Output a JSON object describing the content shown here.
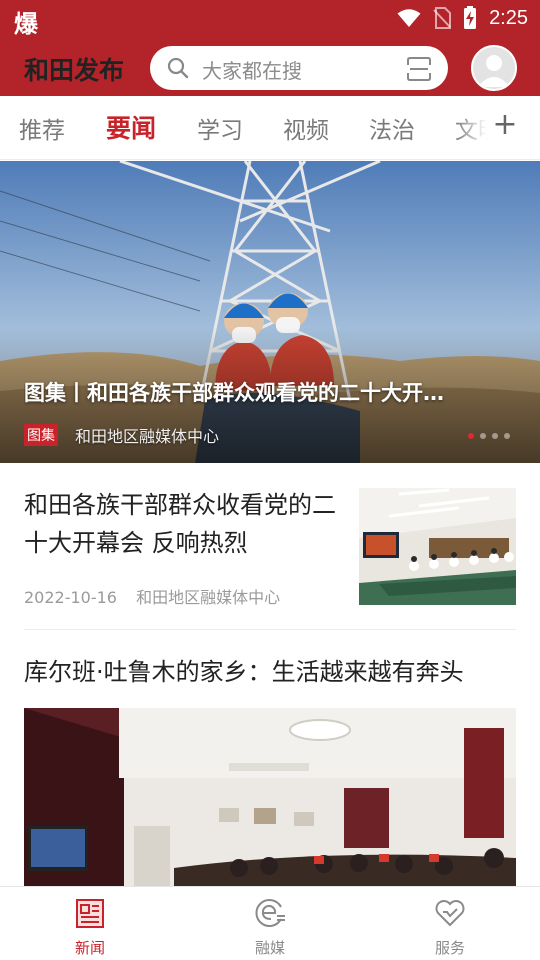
{
  "status_bar": {
    "left_glyph": "爆",
    "time": "2:25",
    "icons": [
      "wifi-icon",
      "no-sim-icon",
      "battery-charging-icon"
    ]
  },
  "header": {
    "title": "和田发布",
    "search_placeholder": "大家都在搜",
    "icons": [
      "search-icon",
      "scan-icon",
      "avatar-icon"
    ]
  },
  "tabs": {
    "items": [
      "推荐",
      "要闻",
      "学习",
      "视频",
      "法治",
      "文明"
    ],
    "active": "要闻",
    "add_icon": "plus-icon"
  },
  "banner": {
    "title": "图集丨和田各族干部群众观看党的二十大开…",
    "tag": "图集",
    "source": "和田地区融媒体中心",
    "slide_count": 4,
    "active_slide": 1
  },
  "articles": [
    {
      "title": "和田各族干部群众收看党的二十大开幕会 反响热烈",
      "date": "2022-10-16",
      "source": "和田地区融媒体中心"
    },
    {
      "title": "库尔班·吐鲁木的家乡：生活越来越有奔头"
    }
  ],
  "bottom_nav": {
    "items": [
      {
        "label": "新闻",
        "icon": "news-icon"
      },
      {
        "label": "融媒",
        "icon": "media-icon"
      },
      {
        "label": "服务",
        "icon": "heart-icon"
      }
    ],
    "active": "新闻"
  },
  "colors": {
    "brand_red": "#b3242a",
    "active_red": "#c8232b",
    "text_dark": "#222222",
    "text_muted": "#9a9a9a"
  }
}
